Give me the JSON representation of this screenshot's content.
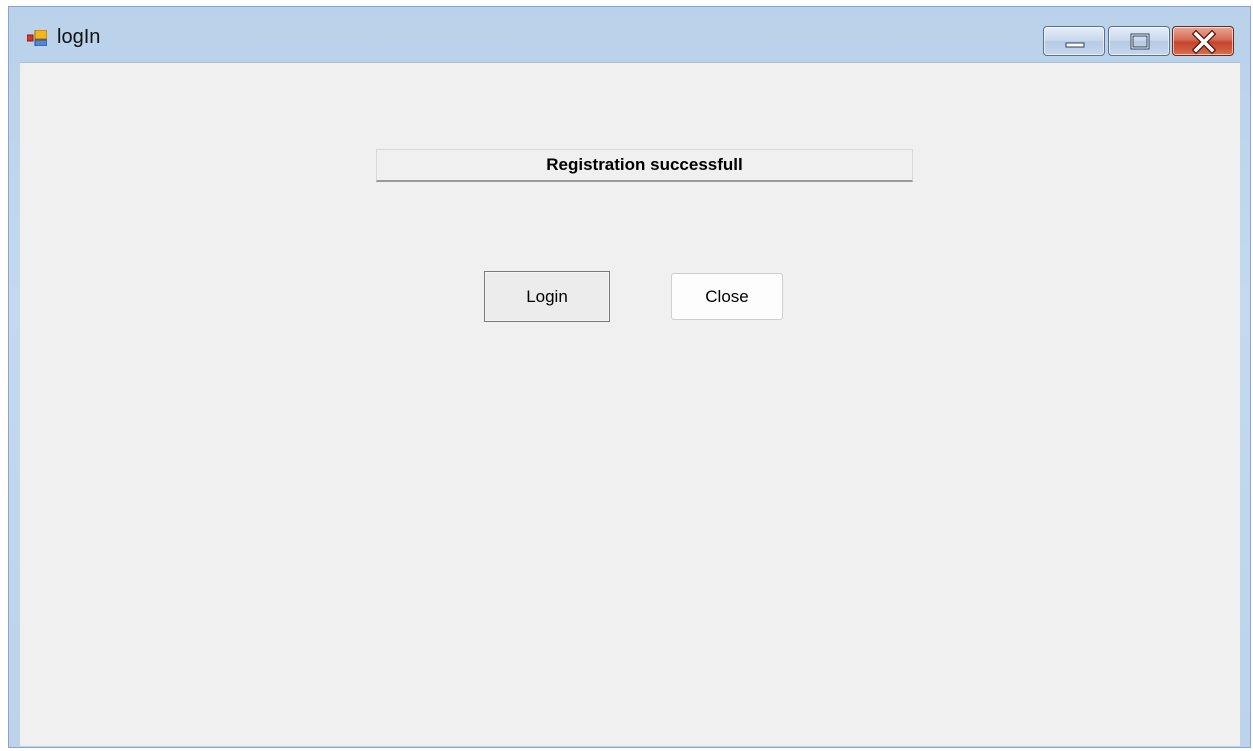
{
  "window": {
    "title": "logIn",
    "icon": "windows-form-icon",
    "controls": {
      "minimize_icon": "minimize-icon",
      "maximize_icon": "maximize-icon",
      "close_icon": "close-icon"
    }
  },
  "form": {
    "status_message": "Registration successfull",
    "login_button_label": "Login",
    "close_button_label": "Close"
  },
  "colors": {
    "title_bar": "#b9d1ea",
    "client_background": "#f0f0f0",
    "close_caption_button": "#c4432b"
  }
}
